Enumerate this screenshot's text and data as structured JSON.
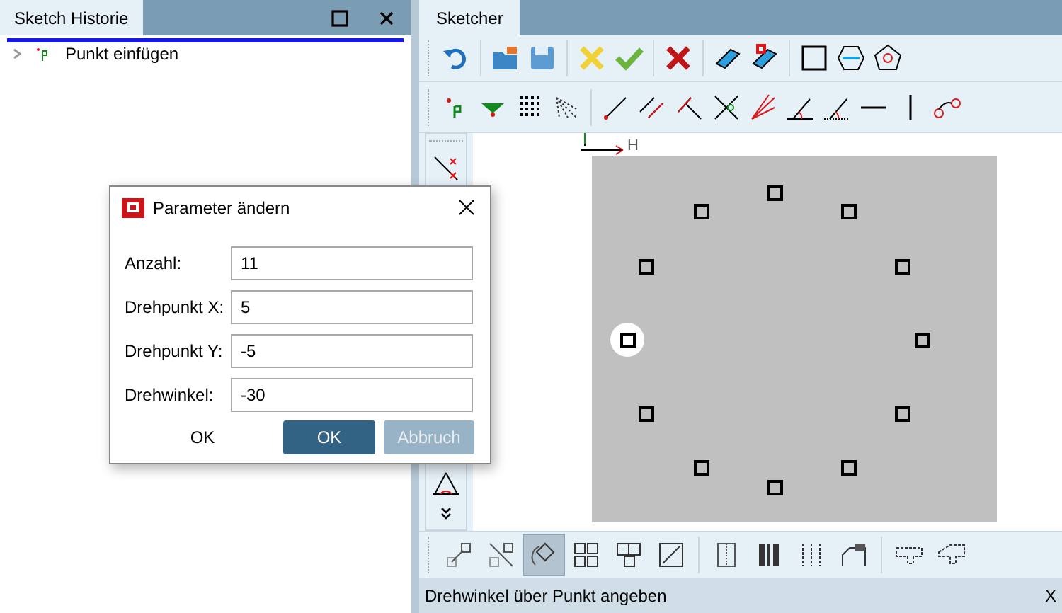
{
  "history_panel": {
    "title": "Sketch Historie",
    "items": [
      {
        "label": "Punkt einfügen",
        "expanded": false
      }
    ]
  },
  "sketcher": {
    "tab": "Sketcher",
    "bottom_tools": [
      {
        "selected": false
      },
      {
        "selected": false
      },
      {
        "selected": true
      },
      {
        "selected": false
      },
      {
        "selected": false
      },
      {
        "selected": false
      },
      {
        "selected": false
      },
      {
        "selected": false
      },
      {
        "selected": false
      },
      {
        "selected": false
      },
      {
        "selected": false
      },
      {
        "selected": false
      }
    ]
  },
  "canvas": {
    "axis_label": "H",
    "points": [
      {
        "selected": false
      },
      {
        "selected": false
      },
      {
        "selected": false
      },
      {
        "selected": false
      },
      {
        "selected": false
      },
      {
        "selected": false
      },
      {
        "selected": false
      },
      {
        "selected": false
      },
      {
        "selected": false
      },
      {
        "selected": true
      },
      {
        "selected": false
      },
      {
        "selected": false
      }
    ]
  },
  "dialog": {
    "title": "Parameter ändern",
    "fields": [
      {
        "label": "Anzahl:",
        "value": "11"
      },
      {
        "label": "Drehpunkt X:",
        "value": "5"
      },
      {
        "label": "Drehpunkt Y:",
        "value": "-5"
      },
      {
        "label": "Drehwinkel:",
        "value": "-30"
      }
    ],
    "default_label": "OK",
    "ok_button": "OK",
    "cancel_button": {
      "label": "Abbruch",
      "disabled": true
    }
  },
  "status_bar": {
    "text": "Drehwinkel über Punkt angeben",
    "coordinate": "X"
  }
}
